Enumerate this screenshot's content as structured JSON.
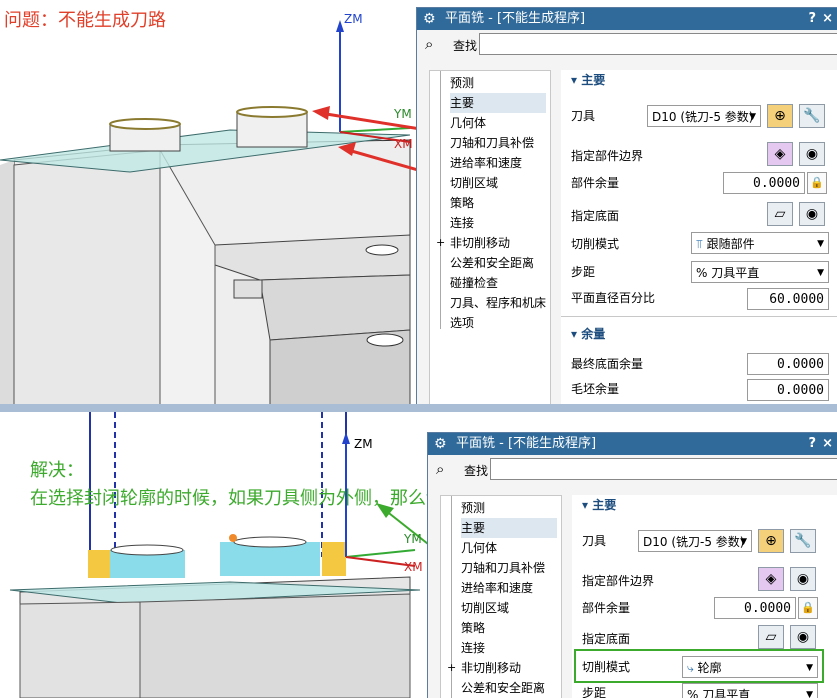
{
  "top": {
    "annotation": "问题：不能生成刀路",
    "axes": {
      "zm": "ZM",
      "ym": "YM",
      "xm": "XM"
    },
    "dialog": {
      "title": "平面铣 - [不能生成程序]",
      "help": "?",
      "close": "×",
      "find_label": "查找",
      "nav": [
        "预测",
        "主要",
        "几何体",
        "刀轴和刀具补偿",
        "进给率和速度",
        "切削区域",
        "策略",
        "连接",
        "非切削移动",
        "公差和安全距离",
        "碰撞检查",
        "刀具、程序和机床",
        "选项"
      ],
      "main_section": "主要",
      "tool_label": "刀具",
      "tool_value": "D10 (铣刀-5 参数)",
      "part_boundary_label": "指定部件边界",
      "part_stock_label": "部件余量",
      "part_stock_value": "0.0000",
      "floor_label": "指定底面",
      "cut_pattern_label": "切削模式",
      "cut_pattern_value": "跟随部件",
      "stepover_label": "步距",
      "stepover_value": "% 刀具平直",
      "percent_label": "平面直径百分比",
      "percent_value": "60.0000",
      "stock_section": "余量",
      "final_floor_label": "最终底面余量",
      "final_floor_value": "0.0000",
      "blank_stock_label": "毛坯余量",
      "blank_stock_value": "0.0000"
    }
  },
  "bottom": {
    "annotation_line1": "解决：",
    "annotation_line2": "在选择封闭轮廓的时候，如果刀具侧为外侧，那么切削模式只能选择轮廓",
    "axes": {
      "zm": "ZM",
      "ym": "YM",
      "xm": "XM"
    },
    "dialog": {
      "title": "平面铣 - [不能生成程序]",
      "help": "?",
      "close": "×",
      "find_label": "查找",
      "nav": [
        "预测",
        "主要",
        "几何体",
        "刀轴和刀具补偿",
        "进给率和速度",
        "切削区域",
        "策略",
        "连接",
        "非切削移动",
        "公差和安全距离"
      ],
      "main_section": "主要",
      "tool_label": "刀具",
      "tool_value": "D10 (铣刀-5 参数)",
      "part_boundary_label": "指定部件边界",
      "part_stock_label": "部件余量",
      "part_stock_value": "0.0000",
      "floor_label": "指定底面",
      "cut_pattern_label": "切削模式",
      "cut_pattern_value": "轮廓",
      "stepover_label": "步距",
      "stepover_value": "% 刀具平直"
    }
  },
  "colors": {
    "title_bar": "#2f6a9b",
    "red_note": "#e0402a",
    "green_note": "#3caa2c",
    "selected_nav": "#dde7f0"
  }
}
